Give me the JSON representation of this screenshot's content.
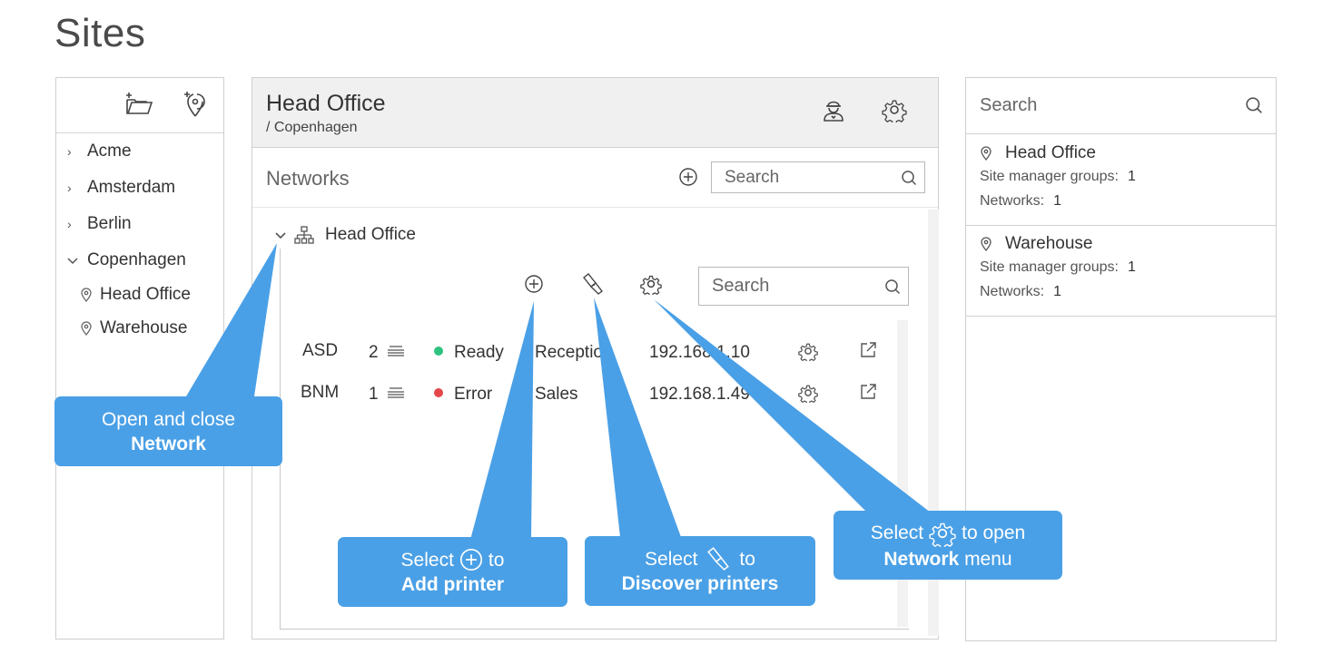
{
  "page": {
    "title": "Sites"
  },
  "sidebar": {
    "tools": [
      {
        "icon": "add-folder-icon"
      },
      {
        "icon": "add-location-icon"
      }
    ],
    "tree": [
      {
        "label": "Acme",
        "state": "collapsed"
      },
      {
        "label": "Amsterdam",
        "state": "collapsed"
      },
      {
        "label": "Berlin",
        "state": "collapsed"
      },
      {
        "label": "Copenhagen",
        "state": "expanded"
      },
      {
        "label": "Head Office",
        "type": "site"
      },
      {
        "label": "Warehouse",
        "type": "site"
      }
    ]
  },
  "site": {
    "title": "Head Office",
    "breadcrumb": "/ Copenhagen",
    "networks_label": "Networks",
    "networks_search_placeholder": "Search",
    "network": {
      "name": "Head Office",
      "search_placeholder": "Search",
      "printers": [
        {
          "name": "ASD",
          "count": "2",
          "status": "Ready",
          "status_color": "#2ec27e",
          "location": "Reception",
          "ip": "192.168.1.10"
        },
        {
          "name": "BNM",
          "count": "1",
          "status": "Error",
          "status_color": "#e5474b",
          "location": "Sales",
          "ip": "192.168.1.49"
        }
      ]
    }
  },
  "results": {
    "search_placeholder": "Search",
    "sites": [
      {
        "name": "Head Office",
        "groups_label": "Site manager groups:",
        "groups": "1",
        "networks_label": "Networks:",
        "networks": "1"
      },
      {
        "name": "Warehouse",
        "groups_label": "Site manager groups:",
        "groups": "1",
        "networks_label": "Networks:",
        "networks": "1"
      }
    ]
  },
  "callouts": {
    "network_toggle": {
      "line1": "Open and close",
      "line2": "Network"
    },
    "add_printer": {
      "pre": "Select",
      "post": "to",
      "line2": "Add printer"
    },
    "discover": {
      "pre": "Select",
      "post": "to",
      "line2": "Discover printers"
    },
    "network_menu": {
      "pre": "Select",
      "post": "to open",
      "strong": "Network",
      "rest": " menu"
    }
  },
  "colors": {
    "accent": "#4aa0e6",
    "ready": "#2ec27e",
    "error": "#e5474b"
  }
}
